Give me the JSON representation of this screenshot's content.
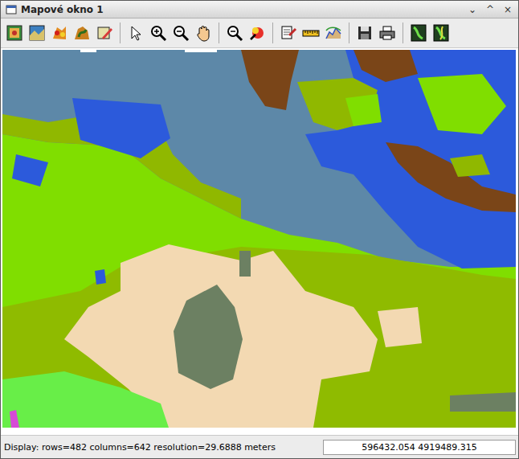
{
  "window": {
    "title": "Mapové okno 1",
    "controls": [
      "⌄",
      "^",
      "×"
    ]
  },
  "status_bar": {
    "display": "Display: rows=482 columns=642  resolution=29.6888 meters",
    "coordinates": "596432.054 4919489.315"
  }
}
